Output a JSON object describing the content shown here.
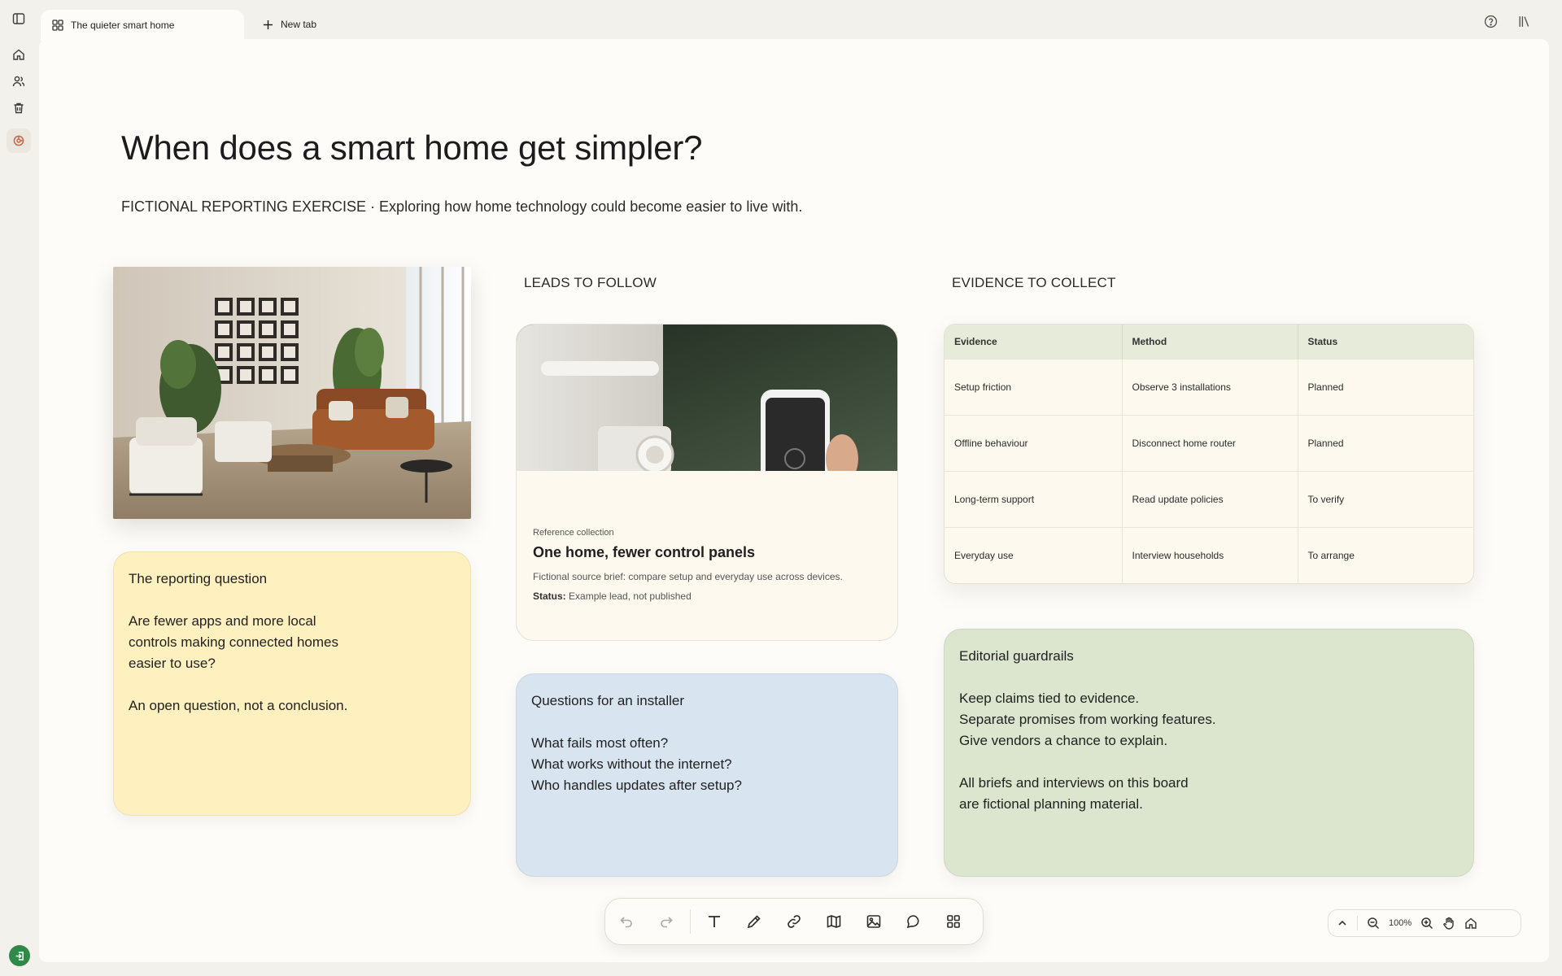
{
  "tabs": {
    "active_label": "The quieter smart home",
    "new_tab_label": "New tab"
  },
  "board": {
    "title": "When does a smart home get simpler?",
    "subtitle": "FICTIONAL REPORTING EXERCISE · Exploring how home technology could become easier to live with."
  },
  "notes": {
    "reporting": "The reporting question\n\nAre fewer apps and more local\ncontrols making connected homes\neasier to use?\n\nAn open question, not a conclusion.",
    "installer": "Questions for an installer\n\nWhat fails most often?\nWhat works without the internet?\nWho handles updates after setup?",
    "guardrails": "Editorial guardrails\n\nKeep claims tied to evidence.\nSeparate promises from working features.\nGive vendors a chance to explain.\n\nAll briefs and interviews on this board\nare fictional planning material."
  },
  "leads": {
    "heading": "LEADS TO FOLLOW",
    "card": {
      "eyebrow": "Reference collection",
      "title": "One home, fewer control panels",
      "description": "Fictional source brief: compare setup and everyday use across devices.",
      "status_label": "Status:",
      "status_value": "Example lead, not published"
    }
  },
  "evidence": {
    "heading": "EVIDENCE TO COLLECT",
    "columns": [
      "Evidence",
      "Method",
      "Status"
    ],
    "rows": [
      [
        "Setup friction",
        "Observe 3 installations",
        "Planned"
      ],
      [
        "Offline behaviour",
        "Disconnect home router",
        "Planned"
      ],
      [
        "Long-term support",
        "Read update policies",
        "To verify"
      ],
      [
        "Everyday use",
        "Interview households",
        "To arrange"
      ]
    ]
  },
  "zoom": {
    "level": "100%"
  },
  "icons": {
    "rail": [
      "sidebar-toggle-icon",
      "home-icon",
      "people-icon",
      "trash-icon",
      "board-icon",
      "exit-icon"
    ],
    "toolbar": [
      "undo-icon",
      "redo-icon",
      "text-icon",
      "pen-icon",
      "link-icon",
      "map-icon",
      "image-icon",
      "comment-icon",
      "grid-icon"
    ]
  },
  "colors": {
    "accent": "#c06a4e",
    "exit_button": "#2f8a4a",
    "note_yellow": "#fff0bf",
    "note_blue": "#d8e4ef",
    "note_green": "#dce5ce"
  }
}
